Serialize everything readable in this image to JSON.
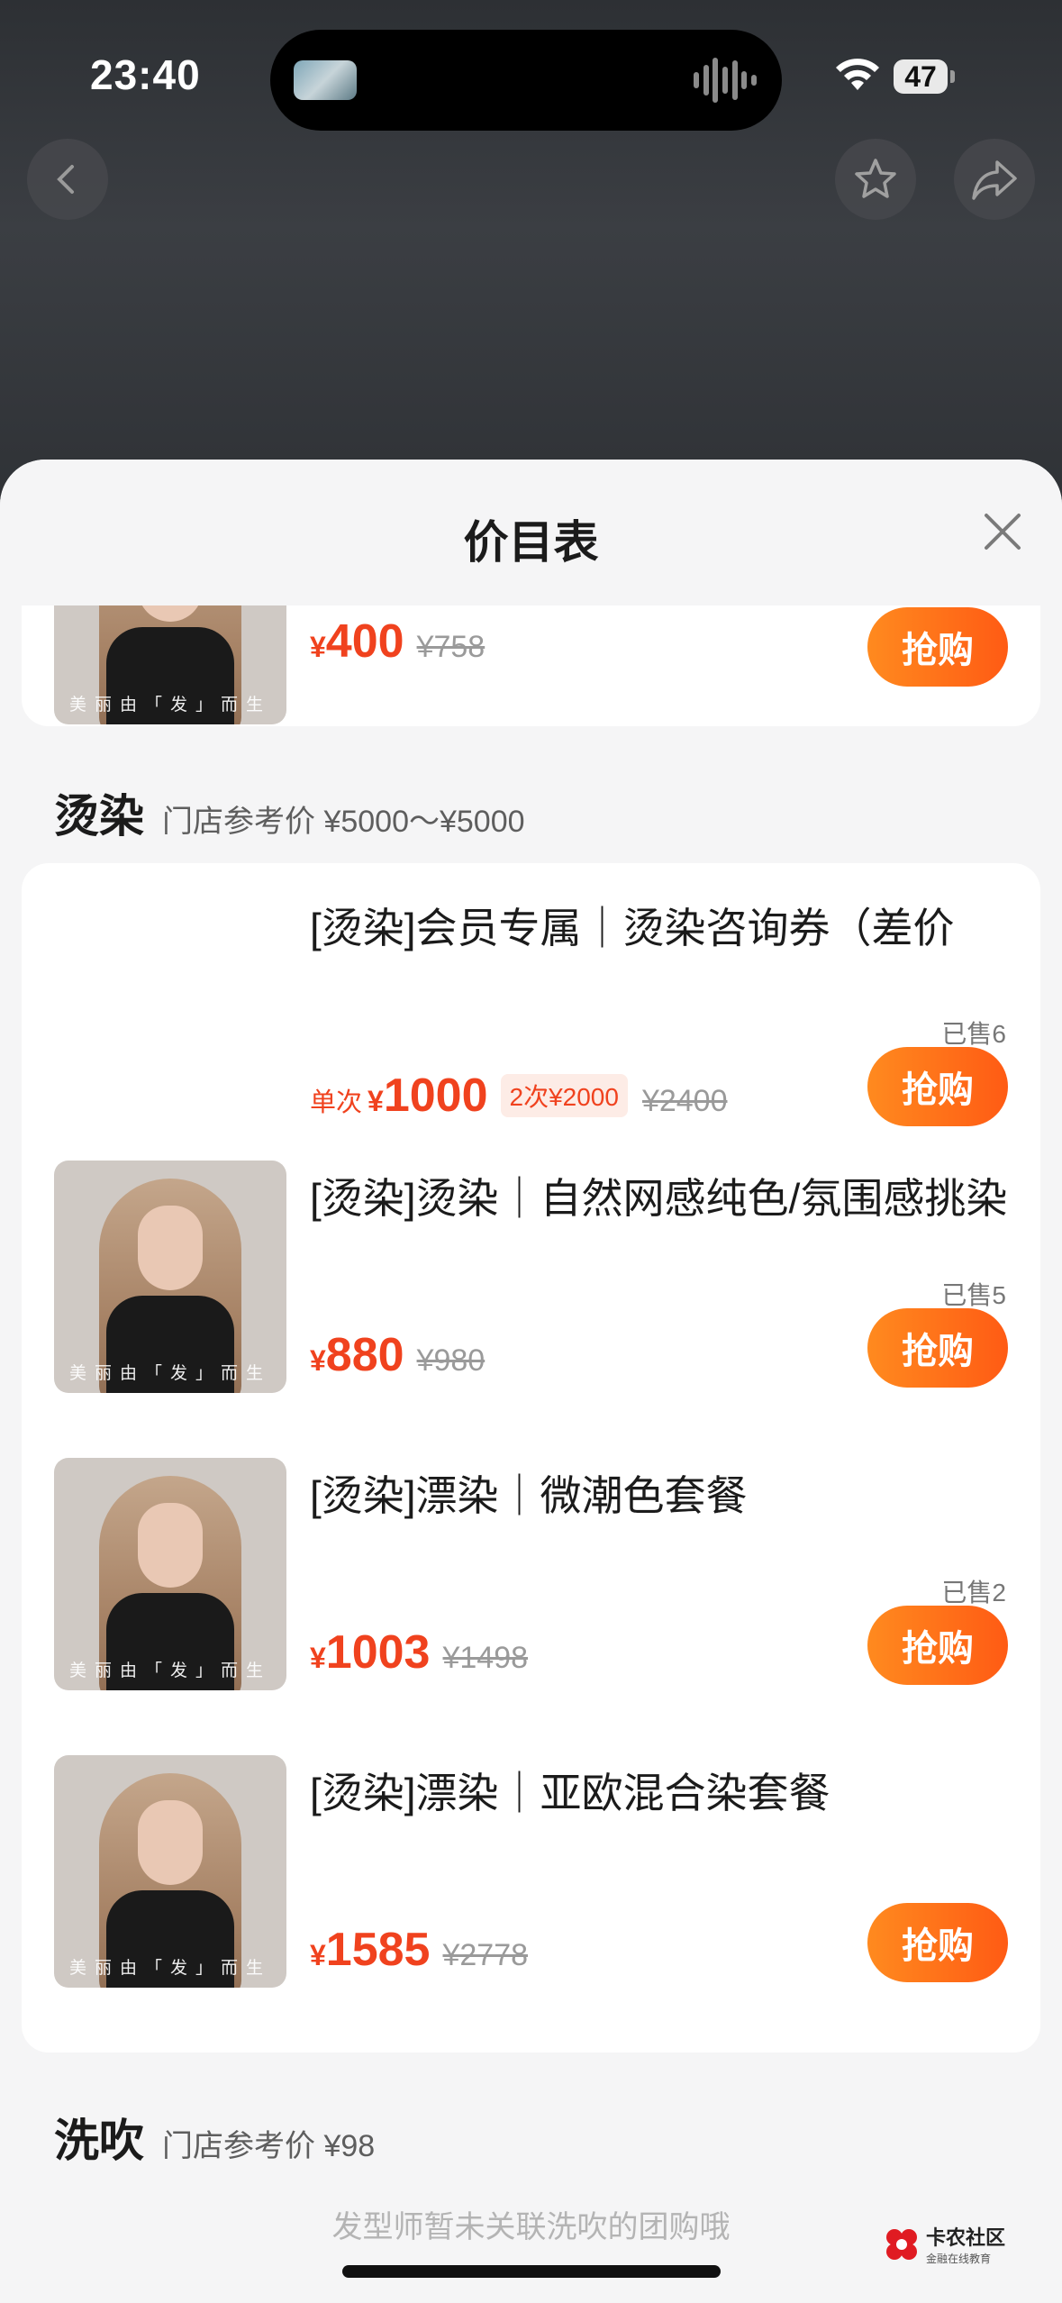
{
  "status_bar": {
    "time": "23:40",
    "battery": "47"
  },
  "sheet": {
    "title": "价目表"
  },
  "top_item": {
    "price": "400",
    "original": "¥758",
    "buy_label": "抢购",
    "thumb_caption": "美丽由「发」而生"
  },
  "sections": [
    {
      "name": "烫染",
      "ref": "门店参考价 ¥5000～¥5000"
    },
    {
      "name": "洗吹",
      "ref": "门店参考价 ¥98"
    }
  ],
  "items": [
    {
      "title": "[烫染]会员专属｜烫染咨询券（差价",
      "sold": "已售6",
      "single_label": "单次",
      "price": "1000",
      "bundle": "2次¥2000",
      "original": "¥2400",
      "buy_label": "抢购"
    },
    {
      "title": "[烫染]烫染｜自然网感纯色/氛围感挑染",
      "sold": "已售5",
      "price": "880",
      "original": "¥980",
      "buy_label": "抢购",
      "thumb_caption": "美丽由「发」而生"
    },
    {
      "title": "[烫染]漂染｜微潮色套餐",
      "sold": "已售2",
      "price": "1003",
      "original": "¥1498",
      "buy_label": "抢购",
      "thumb_caption": "美丽由「发」而生"
    },
    {
      "title": "[烫染]漂染｜亚欧混合染套餐",
      "price": "1585",
      "original": "¥2778",
      "buy_label": "抢购",
      "thumb_caption": "美丽由「发」而生"
    }
  ],
  "currency": "¥",
  "empty_note": "发型师暂未关联洗吹的团购哦",
  "watermark": {
    "main": "卡农社区",
    "sub": "金融在线教育"
  },
  "colors": {
    "accent": "#f0421e",
    "button_start": "#ff8a1f",
    "button_end": "#ff5b14"
  }
}
